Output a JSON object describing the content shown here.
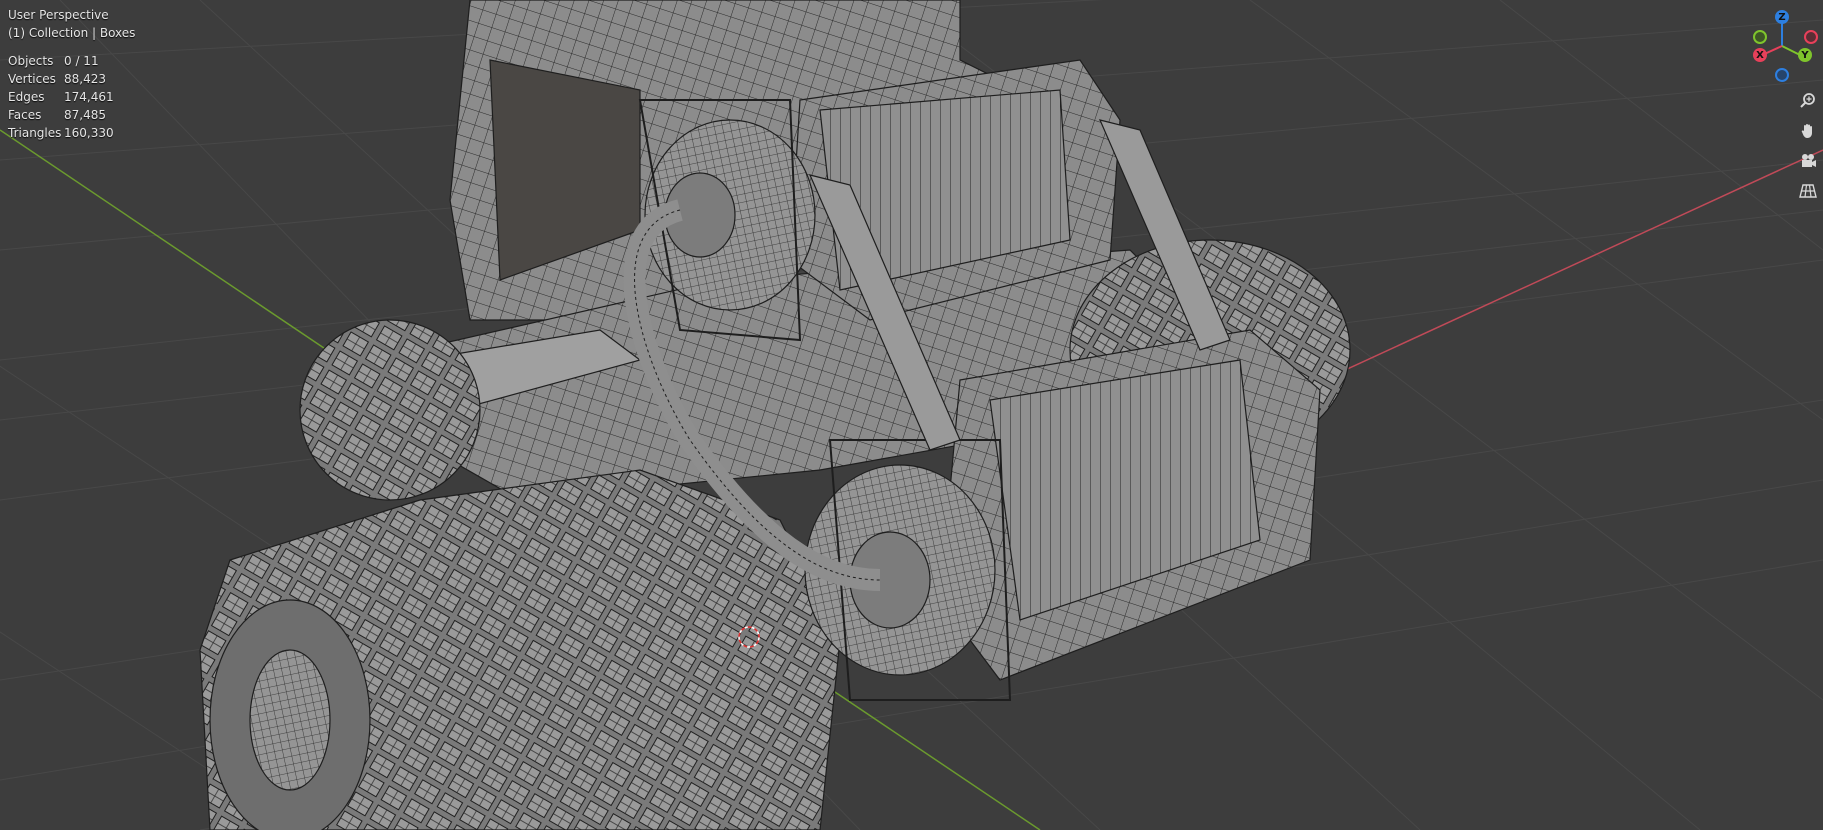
{
  "viewport": {
    "view_name": "User Perspective",
    "collection": "(1) Collection | Boxes",
    "stats": [
      {
        "label": "Objects",
        "value": "0 / 11"
      },
      {
        "label": "Vertices",
        "value": "88,423"
      },
      {
        "label": "Edges",
        "value": "174,461"
      },
      {
        "label": "Faces",
        "value": "87,485"
      },
      {
        "label": "Triangles",
        "value": "160,330"
      }
    ]
  },
  "gizmo": {
    "z_label": "Z",
    "y_label": "Y",
    "x_label": "X",
    "colors": {
      "x": "#e8405a",
      "y": "#7fc52c",
      "z": "#2d7fe0"
    }
  },
  "nav_tools": [
    {
      "name": "zoom-icon"
    },
    {
      "name": "pan-hand-icon"
    },
    {
      "name": "camera-icon"
    },
    {
      "name": "perspective-grid-icon"
    }
  ],
  "colors": {
    "background": "#3d3d3d",
    "grid": "#484848",
    "x_axis_line": "#c04a58",
    "y_axis_line": "#6b9a2e",
    "mesh_fill": "#8a8a8a",
    "mesh_wire": "#1e1e1e"
  }
}
